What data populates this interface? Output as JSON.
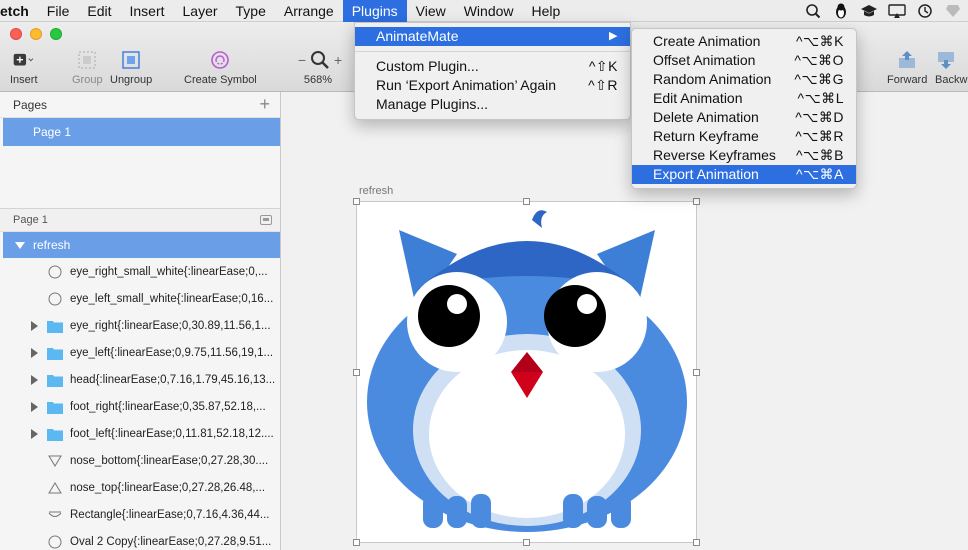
{
  "menubar": {
    "app_name": "etch",
    "items": [
      "File",
      "Edit",
      "Insert",
      "Layer",
      "Type",
      "Arrange",
      "Plugins",
      "View",
      "Window",
      "Help"
    ],
    "active": "Plugins"
  },
  "toolbar": {
    "insert": "Insert",
    "group": "Group",
    "ungroup": "Ungroup",
    "create_symbol": "Create Symbol",
    "zoom_minus": "−",
    "zoom_plus": "+",
    "zoom_level": "568%",
    "forward": "Forward",
    "backward": "Backw"
  },
  "plugins_menu": {
    "items": [
      {
        "label": "AnimateMate",
        "shortcut": "▶",
        "selected": true
      },
      {
        "label": "Custom Plugin...",
        "shortcut": "^⇧K"
      },
      {
        "label": "Run ‘Export Animation’ Again",
        "shortcut": "^⇧R"
      },
      {
        "label": "Manage Plugins...",
        "shortcut": ""
      }
    ]
  },
  "animatemate_menu": {
    "items": [
      {
        "label": "Create Animation",
        "shortcut": "^⌥⌘K"
      },
      {
        "label": "Offset Animation",
        "shortcut": "^⌥⌘O"
      },
      {
        "label": "Random Animation",
        "shortcut": "^⌥⌘G"
      },
      {
        "label": "Edit Animation",
        "shortcut": "^⌥⌘L"
      },
      {
        "label": "Delete Animation",
        "shortcut": "^⌥⌘D"
      },
      {
        "label": "Return Keyframe",
        "shortcut": "^⌥⌘R"
      },
      {
        "label": "Reverse Keyframes",
        "shortcut": "^⌥⌘B"
      },
      {
        "label": "Export Animation",
        "shortcut": "^⌥⌘A",
        "selected": true
      }
    ]
  },
  "pages": {
    "header": "Pages",
    "add": "+",
    "items": [
      "Page 1"
    ]
  },
  "layers": {
    "header": "Page 1",
    "group": "refresh",
    "items": [
      {
        "name": "eye_right_small_white{:linearEase;0,...",
        "icon": "oval-icon"
      },
      {
        "name": "eye_left_small_white{:linearEase;0,16...",
        "icon": "oval-icon"
      },
      {
        "name": "eye_right{:linearEase;0,30.89,11.56,1...",
        "icon": "folder-icon"
      },
      {
        "name": "eye_left{:linearEase;0,9.75,11.56,19,1...",
        "icon": "folder-icon"
      },
      {
        "name": "head{:linearEase;0,7.16,1.79,45.16,13...",
        "icon": "folder-icon"
      },
      {
        "name": "foot_right{:linearEase;0,35.87,52.18,...",
        "icon": "folder-icon"
      },
      {
        "name": "foot_left{:linearEase;0,11.81,52.18,12....",
        "icon": "folder-icon"
      },
      {
        "name": "nose_bottom{:linearEase;0,27.28,30....",
        "icon": "triangle-down-icon"
      },
      {
        "name": "nose_top{:linearEase;0,27.28,26.48,...",
        "icon": "triangle-up-icon"
      },
      {
        "name": "Rectangle{:linearEase;0,7.16,4.36,44...",
        "icon": "rectangle-icon"
      },
      {
        "name": "Oval 2 Copy{:linearEase;0,27.28,9.51...",
        "icon": "oval-icon"
      }
    ]
  },
  "artboard": {
    "name": "refresh"
  },
  "colors": {
    "accent": "#2d6fe0",
    "selection": "#6a9fe8",
    "owl_blue": "#4a8be0",
    "owl_dark": "#2d66c4",
    "owl_belly": "#cfe0f4",
    "nose": "#d0021b"
  }
}
